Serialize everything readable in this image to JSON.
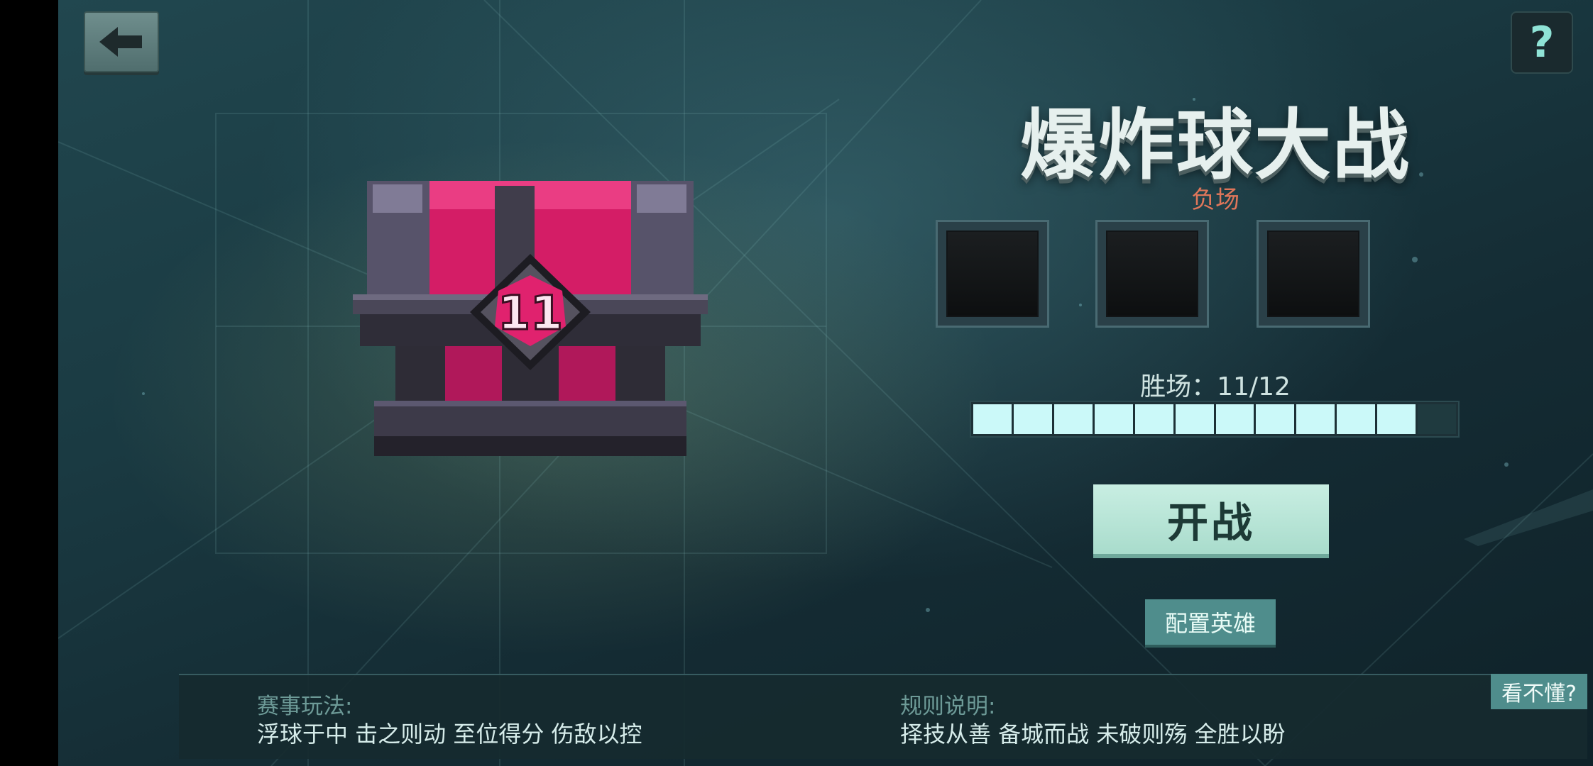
{
  "header": {
    "title": "爆炸球大战"
  },
  "help": {
    "label": "?"
  },
  "chest": {
    "level": "11"
  },
  "losses": {
    "label": "负场",
    "slots": 3,
    "count": 0
  },
  "wins": {
    "label": "胜场：11/12",
    "current": 11,
    "total": 12
  },
  "actions": {
    "start_label": "开战",
    "config_label": "配置英雄"
  },
  "info": {
    "gameplay_label": "赛事玩法:",
    "gameplay_text": "浮球于中 击之则动 至位得分 伤敌以控",
    "rules_label": "规则说明:",
    "rules_text": "择技从善 备城而战 未破则殇 全胜以盼",
    "confused_label": "看不懂?"
  },
  "colors": {
    "accent": "#cbf9f9",
    "loss_red": "#e0765a",
    "chest_pink": "#e0226e"
  }
}
